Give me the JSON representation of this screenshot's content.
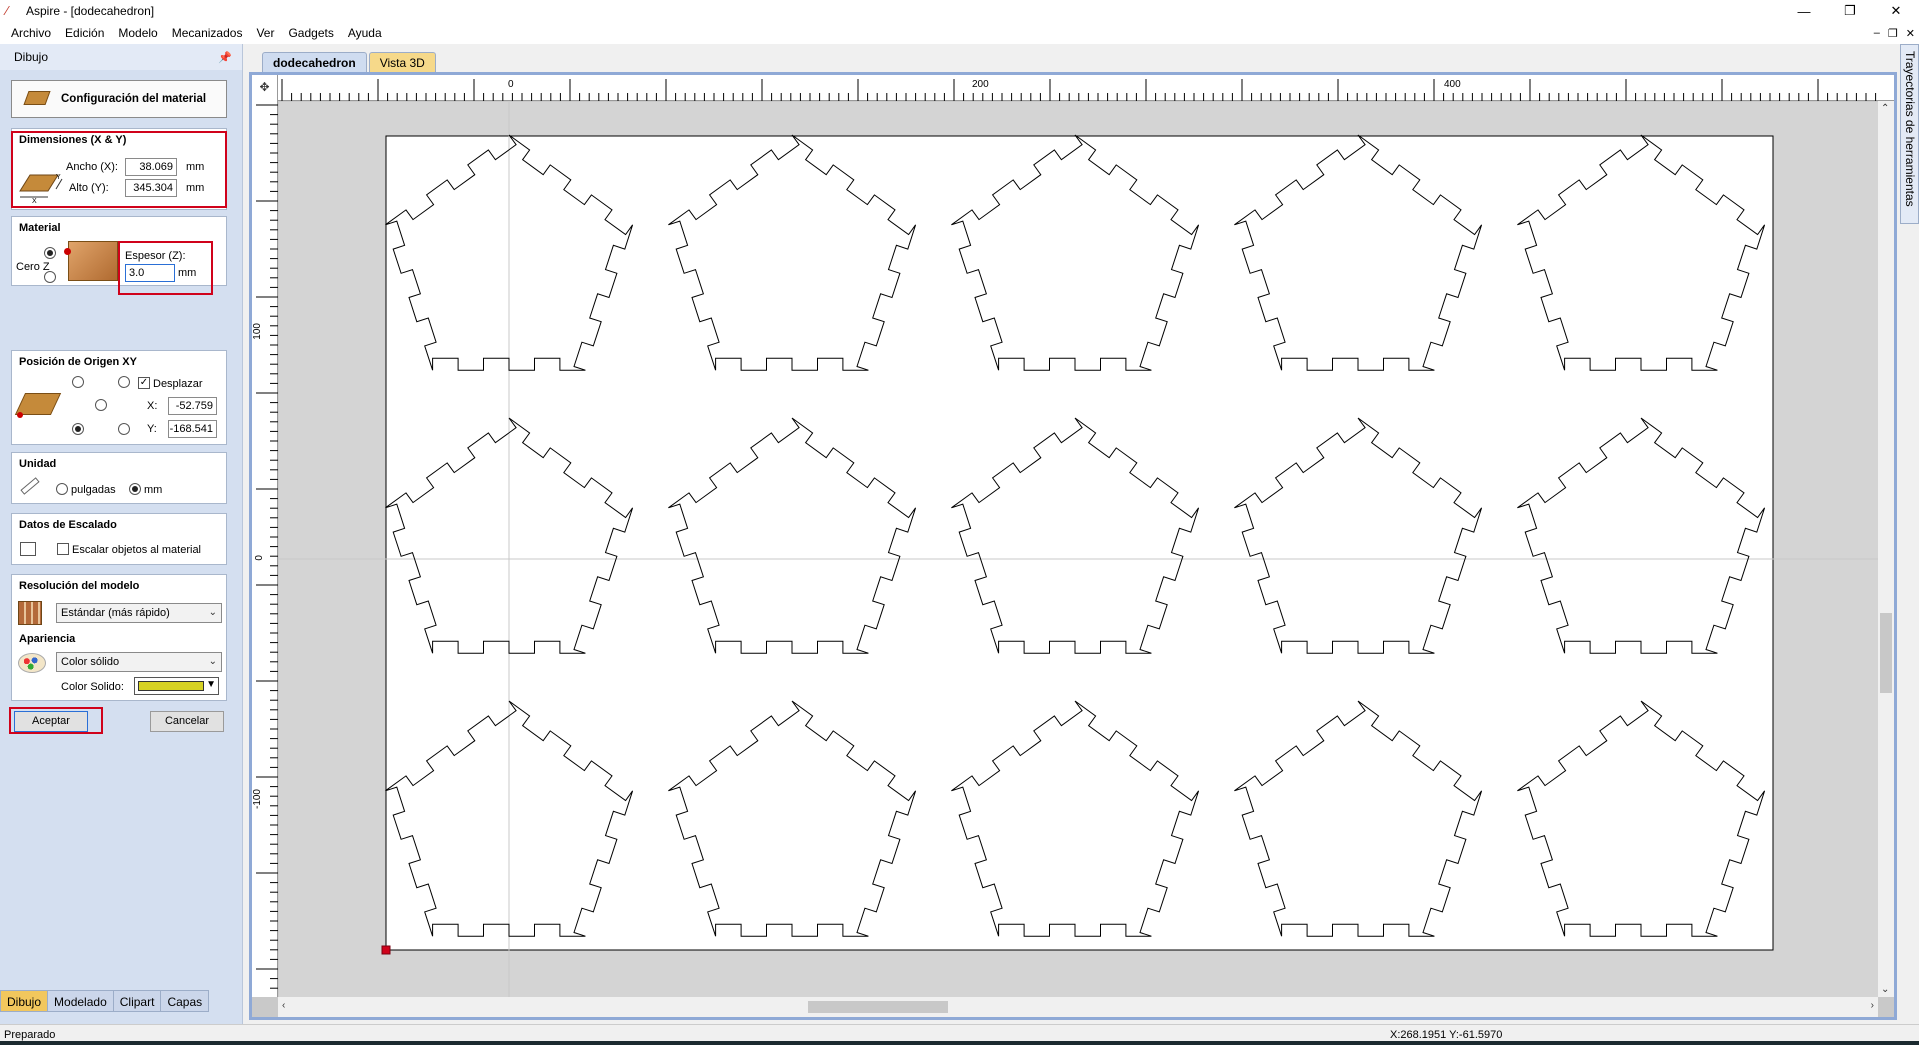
{
  "window": {
    "title": "Aspire - [dodecahedron]",
    "controls": [
      "—",
      "❐",
      "✕"
    ],
    "mdi_controls": [
      "–",
      "❐",
      "✕"
    ]
  },
  "menu": [
    "Archivo",
    "Edición",
    "Modelo",
    "Mecanizados",
    "Ver",
    "Gadgets",
    "Ayuda"
  ],
  "left_panel": {
    "header": "Dibujo",
    "pin_icon": "pin-icon",
    "material_setup_button": "Configuración del material",
    "dimensions": {
      "title": "Dimensiones (X & Y)",
      "width_label": "Ancho (X):",
      "width_value": "38.069",
      "width_unit": "mm",
      "height_label": "Alto (Y):",
      "height_value": "345.304",
      "height_unit": "mm",
      "axis_x": "X",
      "axis_y": "Y"
    },
    "material": {
      "title": "Material",
      "zero_label": "Cero Z",
      "thickness_label": "Espesor (Z):",
      "thickness_value": "3.0",
      "thickness_unit": "mm"
    },
    "origin": {
      "title": "Posición de Origen XY",
      "offset_label": "Desplazar",
      "offset_checked": true,
      "x_label": "X:",
      "x_value": "-52.759",
      "y_label": "Y:",
      "y_value": "-168.541"
    },
    "units": {
      "title": "Unidad",
      "inches": "pulgadas",
      "mm": "mm",
      "selected": "mm"
    },
    "scaling": {
      "title": "Datos de Escalado",
      "scale_label": "Escalar objetos al material",
      "checked": false
    },
    "resolution": {
      "title": "Resolución del modelo",
      "value": "Estándar (más rápido)"
    },
    "appearance": {
      "title": "Apariencia",
      "value": "Color sólido",
      "color_label": "Color Solido:",
      "color": "#d6d224"
    },
    "accept_button": "Aceptar",
    "cancel_button": "Cancelar",
    "tabs": [
      "Dibujo",
      "Modelado",
      "Clipart",
      "Capas"
    ],
    "active_tab": "Dibujo"
  },
  "document_tabs": [
    "dodecahedron",
    "Vista 3D"
  ],
  "active_document_tab": "dodecahedron",
  "rulers": {
    "top_labels": [
      "0",
      "200",
      "400"
    ],
    "left_labels": [
      "100",
      "0",
      "-100"
    ]
  },
  "right_panel_label": "Trayectorias de herramientas",
  "shapes": {
    "rows": 3,
    "cols": 5,
    "shape": "pentagon-with-tabs"
  },
  "status": {
    "left": "Preparado",
    "coords": "X:268.1951 Y:-61.5970"
  },
  "colors": {
    "accent_red": "#d0021b",
    "canvas_frame": "#8fa9d6",
    "panel_bg": "#d4dff0",
    "active_tab": "#f2c75d"
  }
}
